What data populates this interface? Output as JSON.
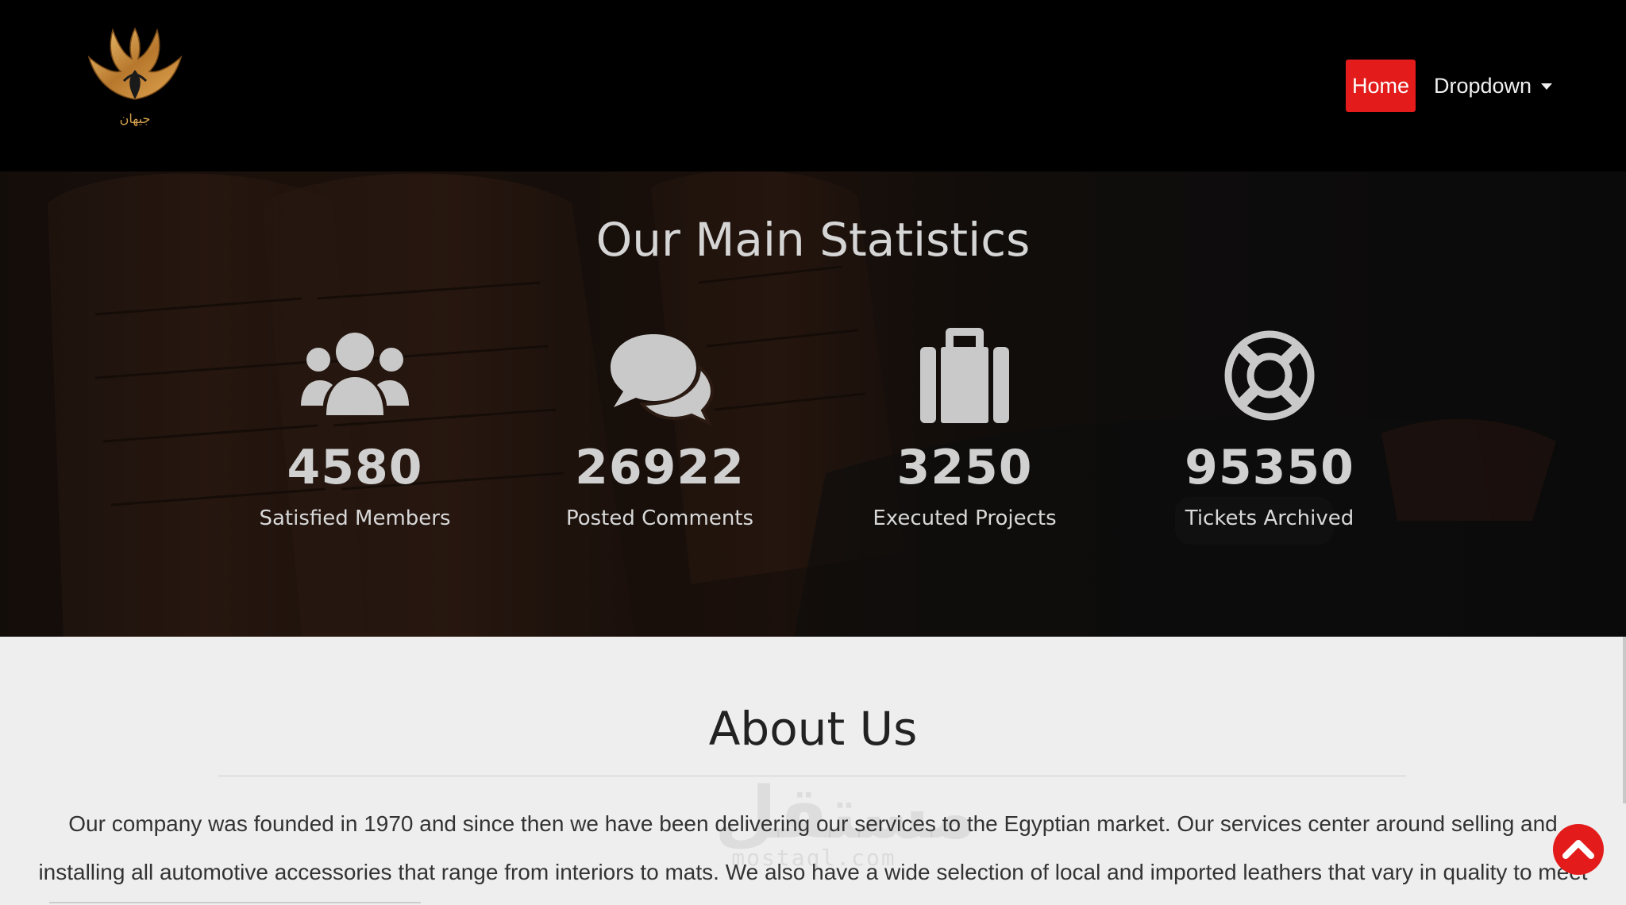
{
  "navbar": {
    "logo_text": "جيهان",
    "home_label": "Home",
    "dropdown_label": "Dropdown",
    "accent_color": "#e31b1b"
  },
  "stats": {
    "title": "Our Main Statistics",
    "items": [
      {
        "icon": "users-icon",
        "number": "4580",
        "label": "Satisfied Members"
      },
      {
        "icon": "comments-icon",
        "number": "26922",
        "label": "Posted Comments"
      },
      {
        "icon": "suitcase-icon",
        "number": "3250",
        "label": "Executed Projects"
      },
      {
        "icon": "life-ring-icon",
        "number": "95350",
        "label": "Tickets Archived"
      }
    ]
  },
  "about": {
    "title": "About Us",
    "text": "Our company was founded in 1970 and since then we have been delivering our services to the Egyptian market. Our services center around selling and installing all automotive accessories that range from interiors to mats. We also have a wide selection of local and imported leathers that vary in quality to meet your requirements.",
    "watermark": "مستقل",
    "watermark_sub": "mostaql.com"
  }
}
